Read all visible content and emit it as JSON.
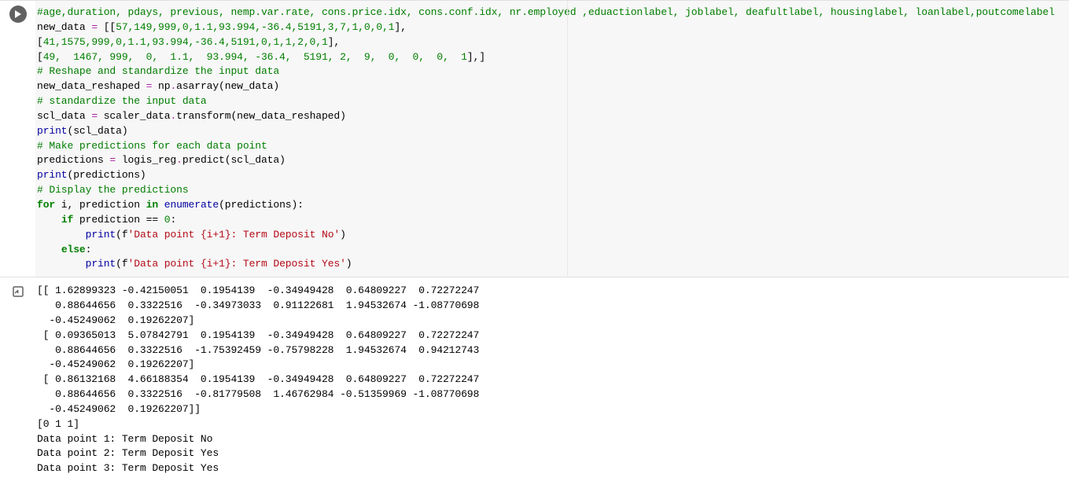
{
  "code": {
    "comment_header": "#age,duration, pdays, previous, nemp.var.rate, cons.price.idx, cons.conf.idx, nr.employed ,eduactionlabel, joblabel, deafultlabel, housinglabel, loanlabel,poutcomelabel",
    "new_data_assign": "new_data = [[",
    "row1": "57,149,999,0,1.1,93.994,-36.4,5191,3,7,1,0,0,1",
    "row1_end": "],",
    "row2_pre": "[",
    "row2": "41,1575,999,0,1.1,93.994,-36.4,5191,0,1,1,2,0,1",
    "row2_end": "],",
    "row3_pre": "[",
    "row3": "49,  1467, 999,  0,  1.1,  93.994, -36.4,  5191, 2,  9,  0,  0,  0,  1",
    "row3_end": "],]",
    "comment_reshape": "# Reshape and standardize the input data",
    "reshape_line_lhs": "new_data_reshaped = np.asarray(new_data)",
    "comment_std": "# standardize the input data",
    "scl_line": "scl_data = scaler_data.transform(new_data_reshaped)",
    "print_scl_pre": "print",
    "print_scl_arg": "(scl_data)",
    "comment_pred": "# Make predictions for each data point",
    "pred_line": "predictions = logis_reg.predict(scl_data)",
    "print_pred_pre": "print",
    "print_pred_arg": "(predictions)",
    "comment_disp": "# Display the predictions",
    "for_kw": "for",
    "for_rest": " i, prediction ",
    "in_kw": "in",
    "enum_fn": " enumerate",
    "enum_arg": "(predictions):",
    "if_kw": "if",
    "if_rest": " prediction == ",
    "zero": "0",
    "colon": ":",
    "print_kw": "print",
    "fstr_no_open": "(f",
    "fstr_no": "'Data point {i+1}: Term Deposit No'",
    "fstr_no_close": ")",
    "else_kw": "else",
    "fstr_yes_open": "(f",
    "fstr_yes": "'Data point {i+1}: Term Deposit Yes'",
    "fstr_yes_close": ")"
  },
  "output": {
    "l1": "[[ 1.62899323 -0.42150051  0.1954139  -0.34949428  0.64809227  0.72272247",
    "l2": "   0.88644656  0.3322516  -0.34973033  0.91122681  1.94532674 -1.08770698",
    "l3": "  -0.45249062  0.19262207]",
    "l4": " [ 0.09365013  5.07842791  0.1954139  -0.34949428  0.64809227  0.72272247",
    "l5": "   0.88644656  0.3322516  -1.75392459 -0.75798228  1.94532674  0.94212743",
    "l6": "  -0.45249062  0.19262207]",
    "l7": " [ 0.86132168  4.66188354  0.1954139  -0.34949428  0.64809227  0.72272247",
    "l8": "   0.88644656  0.3322516  -0.81779508  1.46762984 -0.51359969 -1.08770698",
    "l9": "  -0.45249062  0.19262207]]",
    "l10": "[0 1 1]",
    "l11": "Data point 1: Term Deposit No",
    "l12": "Data point 2: Term Deposit Yes",
    "l13": "Data point 3: Term Deposit Yes"
  }
}
